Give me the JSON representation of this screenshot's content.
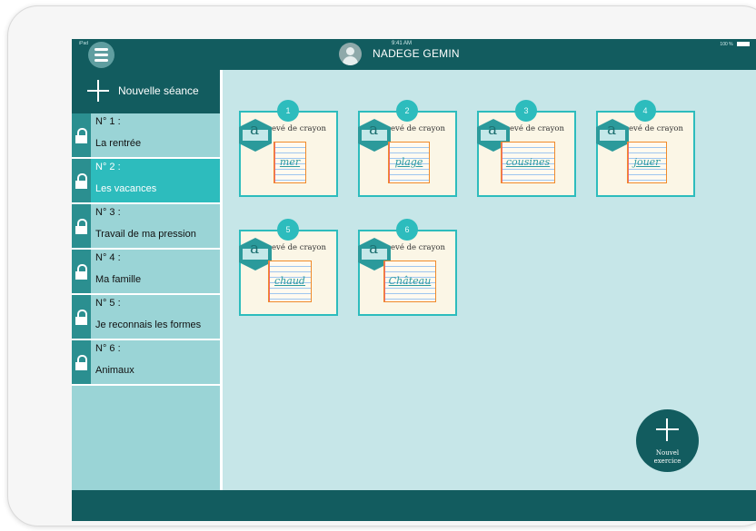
{
  "status_bar": {
    "left": "iPad",
    "time": "9:41 AM",
    "right": "100 %"
  },
  "header": {
    "user_name": "NADEGE GEMIN"
  },
  "sidebar": {
    "new_session_label": "Nouvelle séance",
    "sessions": [
      {
        "number": "N° 1 :",
        "title": "La rentrée",
        "active": false
      },
      {
        "number": "N° 2 :",
        "title": "Les vacances",
        "active": true
      },
      {
        "number": "N° 3 :",
        "title": "Travail de ma pression",
        "active": false
      },
      {
        "number": "N° 4 :",
        "title": "Ma famille",
        "active": false
      },
      {
        "number": "N° 5 :",
        "title": "Je reconnais les formes",
        "active": false
      },
      {
        "number": "N° 6 :",
        "title": "Animaux",
        "active": false
      }
    ]
  },
  "exercises": [
    {
      "number": "1",
      "letter": "a",
      "type": "evé de crayon",
      "word": "mer"
    },
    {
      "number": "2",
      "letter": "a",
      "type": "evé de crayon",
      "word": "plage"
    },
    {
      "number": "3",
      "letter": "a",
      "type": "evé de crayon",
      "word": "cousines"
    },
    {
      "number": "4",
      "letter": "a",
      "type": "evé de crayon",
      "word": "jouer"
    },
    {
      "number": "5",
      "letter": "a",
      "type": "evé de crayon",
      "word": "chaud"
    },
    {
      "number": "6",
      "letter": "a",
      "type": "evé de crayon",
      "word": "Château"
    }
  ],
  "fab": {
    "label_line1": "Nouvel",
    "label_line2": "exercice"
  },
  "colors": {
    "bar": "#125c5f",
    "accent": "#2dbcbd",
    "sidebar": "#9ad4d6",
    "content_bg": "#c6e6e8"
  }
}
